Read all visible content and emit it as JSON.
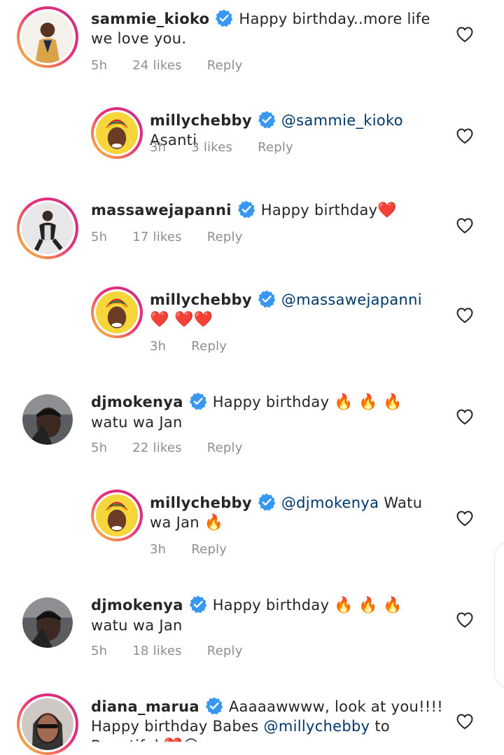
{
  "comments": [
    {
      "username": "sammie_kioko",
      "text_parts": [
        "Happy birthday..more life we love you."
      ],
      "time": "5h",
      "likes": "24 likes",
      "reply": "Reply"
    },
    {
      "username": "millychebby",
      "mention": "@sammie_kioko",
      "text": "Asanti",
      "time": "3h",
      "likes": "3 likes",
      "reply": "Reply"
    },
    {
      "username": "massawejapanni",
      "text": "Happy birthday",
      "emoji": "❤️",
      "time": "5h",
      "likes": "17 likes",
      "reply": "Reply"
    },
    {
      "username": "millychebby",
      "mention": "@massawejapanni",
      "emoji": "❤️ ❤️❤️",
      "time": "3h",
      "reply": "Reply"
    },
    {
      "username": "djmokenya",
      "text": "Happy birthday",
      "emoji": "🔥 🔥 🔥",
      "text2": "watu wa Jan",
      "time": "5h",
      "likes": "22 likes",
      "reply": "Reply"
    },
    {
      "username": "millychebby",
      "mention": "@djmokenya",
      "text": "Watu wa Jan",
      "emoji": "🔥",
      "time": "3h",
      "reply": "Reply"
    },
    {
      "username": "djmokenya",
      "text": "Happy birthday",
      "emoji": "🔥 🔥 🔥",
      "text2": "watu wa Jan",
      "time": "5h",
      "likes": "18 likes",
      "reply": "Reply"
    },
    {
      "username": "diana_marua",
      "text": "Aaaaawwww, look at you!!!! Happy birthday Babes",
      "mention": "@millychebby",
      "text2": "to Beautiful",
      "emoji": "❤️😍"
    }
  ],
  "colors": {
    "verified": "#3897f0",
    "mention": "#00376b",
    "meta": "#8e8e8e",
    "ring_start": "#f9ce34",
    "ring_end": "#c13584"
  }
}
